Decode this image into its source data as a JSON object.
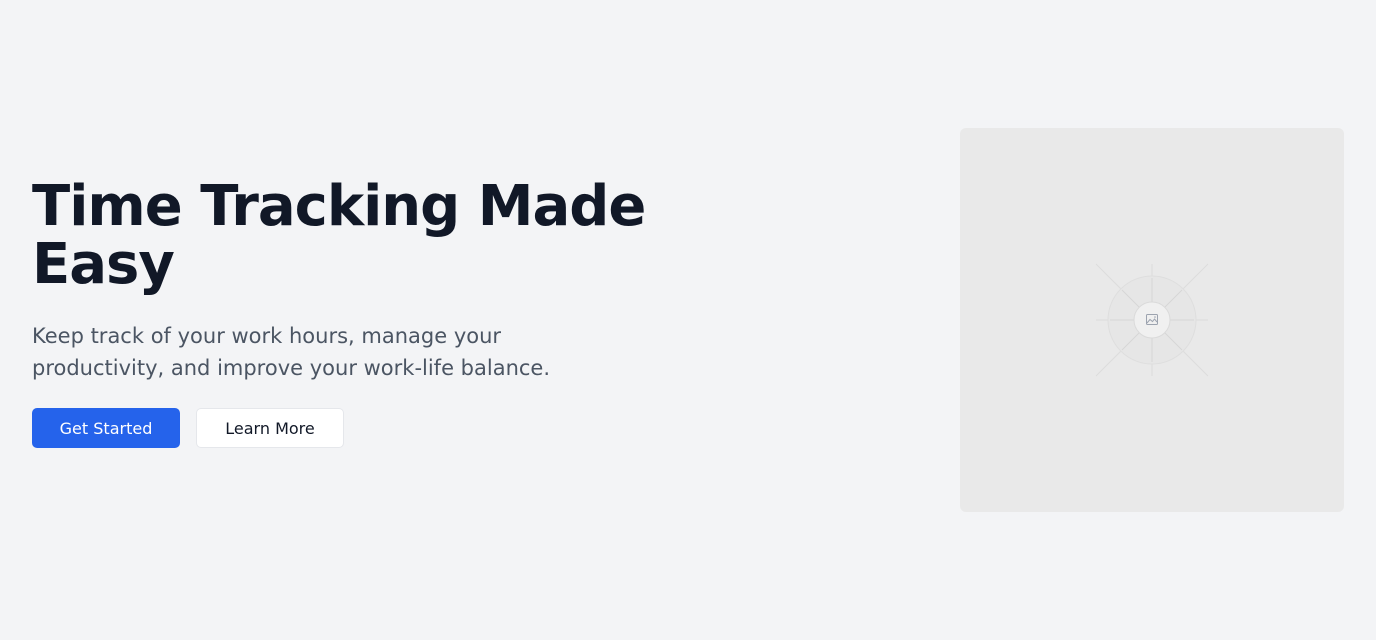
{
  "hero": {
    "title": "Time Tracking Made Easy",
    "subtitle": "Keep track of your work hours, manage your productivity, and improve your work-life balance."
  },
  "actions": {
    "primary_label": "Get Started",
    "secondary_label": "Learn More"
  },
  "media": {
    "icon": "image-icon"
  },
  "colors": {
    "background": "#f3f4f6",
    "accent": "#2563eb",
    "title": "#111827",
    "subtitle": "#4b5563",
    "placeholder": "#e9e9e9"
  }
}
